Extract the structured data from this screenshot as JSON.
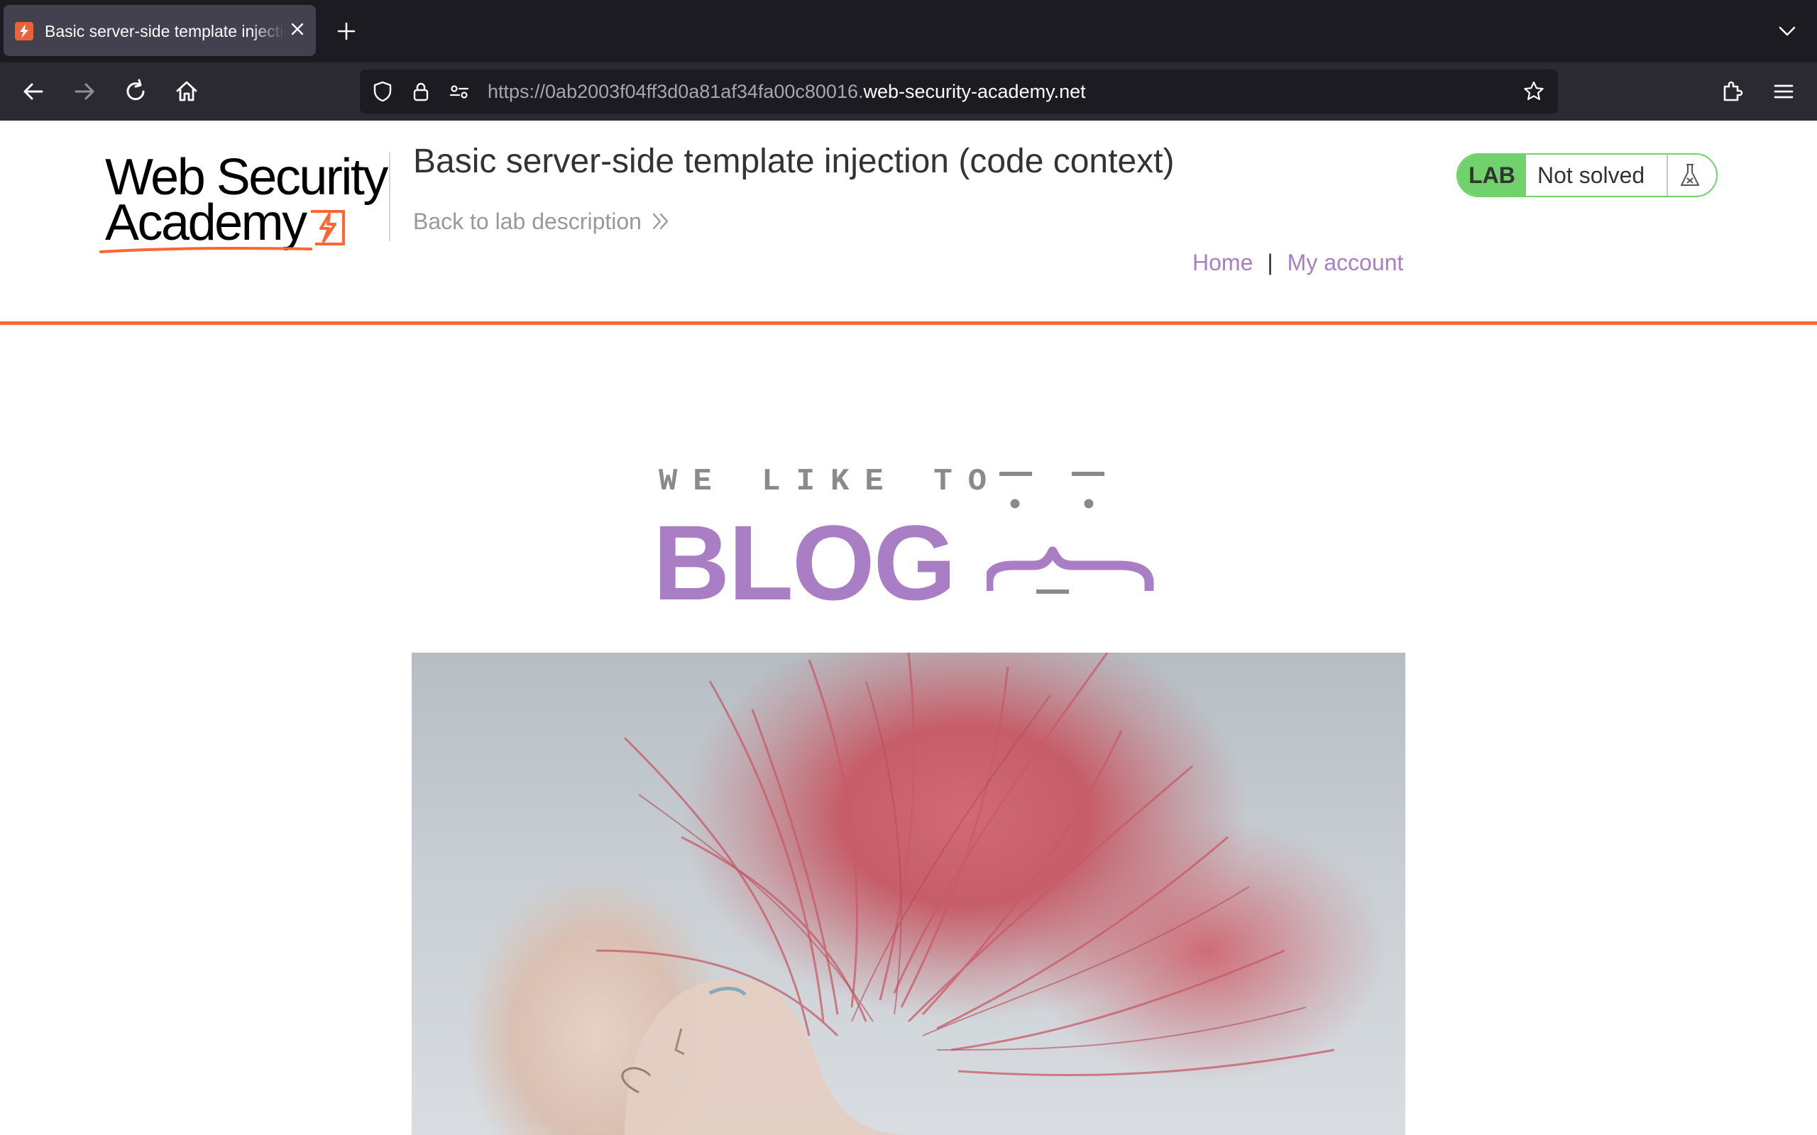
{
  "browser": {
    "tab": {
      "title": "Basic server-side template injection (code context)"
    },
    "url": {
      "dim_part": "https://0ab2003f04ff3d0a81af34fa00c80016.",
      "host_part": "web-security-academy.net"
    }
  },
  "header": {
    "logo": {
      "line1": "Web Security",
      "line2": "Academy"
    },
    "lab_title": "Basic server-side template injection (code context)",
    "back_link": "Back to lab description",
    "lab_badge": {
      "label": "LAB",
      "status": "Not solved"
    }
  },
  "nav": {
    "home": "Home",
    "separator": "|",
    "my_account": "My account"
  },
  "banner": {
    "tagline": "WE LIKE TO",
    "title": "BLOG"
  },
  "hero": {
    "image": "woman with flowing red hair"
  },
  "colors": {
    "accent_orange": "#ff6633",
    "link_purple": "#a97ec4",
    "lab_green": "#70d16d"
  }
}
